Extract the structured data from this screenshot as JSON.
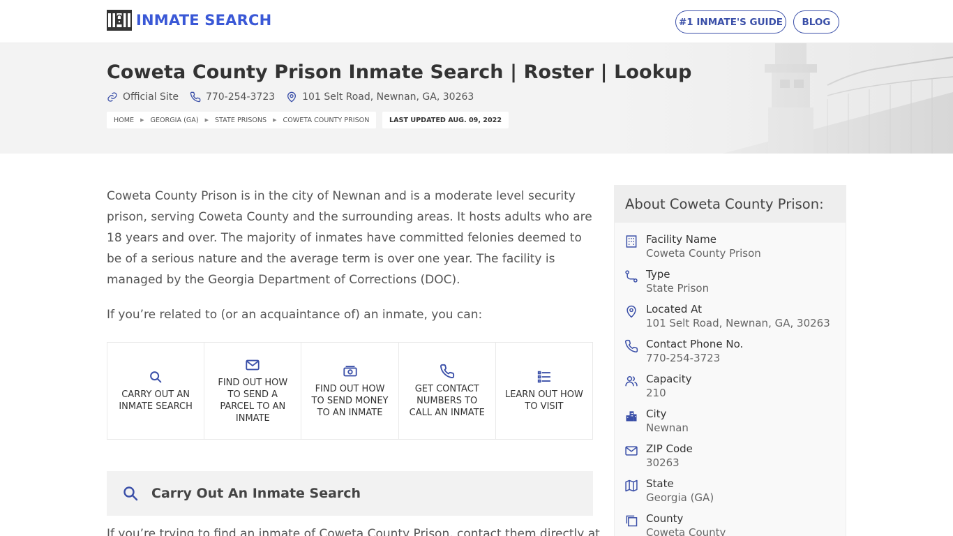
{
  "header": {
    "logo_text": "INMATE SEARCH",
    "nav": [
      {
        "label": "#1 INMATE'S GUIDE"
      },
      {
        "label": "BLOG"
      }
    ]
  },
  "hero": {
    "title": "Coweta County Prison Inmate Search | Roster | Lookup",
    "official_site": "Official Site",
    "phone": "770-254-3723",
    "address": "101 Selt Road, Newnan, GA, 30263",
    "breadcrumbs": [
      "HOME",
      "GEORGIA (GA)",
      "STATE PRISONS",
      "COWETA COUNTY PRISON"
    ],
    "last_updated": "LAST UPDATED AUG. 09, 2022"
  },
  "main": {
    "intro": "Coweta County Prison is in the city of Newnan and is a moderate level security prison, serving Coweta County and the surrounding areas. It hosts adults who are 18 years and over. The majority of inmates have committed felonies deemed to be of a serious nature and the average term is over one year. The facility is managed by the Georgia Department of Corrections (DOC).",
    "lead": "If you’re related to (or an acquaintance of) an inmate, you can:",
    "actions": [
      {
        "label": "CARRY OUT AN INMATE SEARCH",
        "icon": "search-icon"
      },
      {
        "label": "FIND OUT HOW TO SEND A PARCEL TO AN INMATE",
        "icon": "envelope-icon"
      },
      {
        "label": "FIND OUT HOW TO SEND MONEY TO AN INMATE",
        "icon": "money-icon"
      },
      {
        "label": "GET CONTACT NUMBERS TO CALL AN INMATE",
        "icon": "phone-icon"
      },
      {
        "label": "LEARN OUT HOW TO VISIT",
        "icon": "list-icon"
      }
    ],
    "section_title": "Carry Out An Inmate Search",
    "cutoff_text": "If you’re trying to find an inmate of Coweta County Prison, contact them directly at"
  },
  "sidebar": {
    "title": "About Coweta County Prison:",
    "facts": [
      {
        "label": "Facility Name",
        "value": "Coweta County Prison",
        "icon": "building-icon"
      },
      {
        "label": "Type",
        "value": "State Prison",
        "icon": "route-icon"
      },
      {
        "label": "Located At",
        "value": "101 Selt Road, Newnan, GA, 30263",
        "icon": "map-pin-icon"
      },
      {
        "label": "Contact Phone No.",
        "value": "770-254-3723",
        "icon": "phone-icon"
      },
      {
        "label": "Capacity",
        "value": "210",
        "icon": "users-icon"
      },
      {
        "label": "City",
        "value": "Newnan",
        "icon": "city-icon"
      },
      {
        "label": "ZIP Code",
        "value": "30263",
        "icon": "envelope-icon"
      },
      {
        "label": "State",
        "value": "Georgia (GA)",
        "icon": "map-icon"
      },
      {
        "label": "County",
        "value": "Coweta County",
        "icon": "copy-icon"
      }
    ]
  },
  "colors": {
    "brand": "#3a58d6",
    "nav_border": "#3a4fa8",
    "text": "#333333",
    "muted": "#555555",
    "hero_bg": "#f3f3f3"
  }
}
